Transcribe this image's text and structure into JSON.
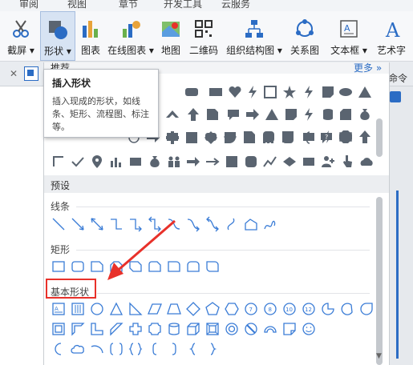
{
  "menu_tabs": [
    "审阅",
    "视图",
    "章节",
    "开发工具",
    "云服务"
  ],
  "ribbon": {
    "screenshot_label": "截屏",
    "shapes_label": "形状",
    "chart_label": "图表",
    "online_chart_label": "在线图表",
    "map_label": "地图",
    "qrcode_label": "二维码",
    "org_chart_label": "组织结构图",
    "relation_label": "关系图",
    "textbox_label": "文本框",
    "art_label": "艺术字"
  },
  "tab_strip": {
    "recommend_label": "推荐",
    "command_label": "命令"
  },
  "panel": {
    "more_label": "更多",
    "preset_header": "预设",
    "lines_label": "线条",
    "rect_label": "矩形",
    "basic_label": "基本形状"
  },
  "tooltip": {
    "title": "插入形状",
    "description": "插入现成的形状，如线条、矩形、流程图、标注等。"
  },
  "colors": {
    "accent": "#2b6cc4",
    "shape_fill": "#5a6470",
    "annotation_red": "#e8312a"
  }
}
